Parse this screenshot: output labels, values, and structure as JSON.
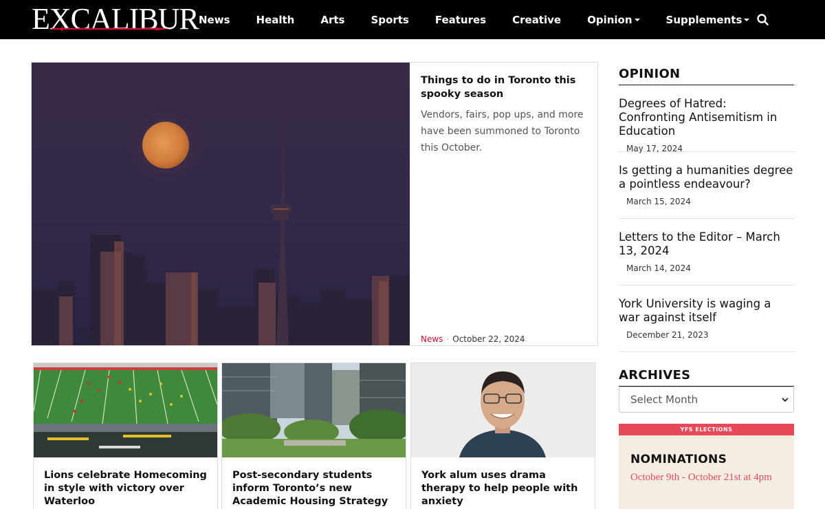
{
  "site": {
    "logo_text": "EXCALIBUR"
  },
  "nav": {
    "items": [
      {
        "label": "News"
      },
      {
        "label": "Health"
      },
      {
        "label": "Arts"
      },
      {
        "label": "Sports"
      },
      {
        "label": "Features"
      },
      {
        "label": "Creative"
      },
      {
        "label": "Opinion"
      },
      {
        "label": "Supplements"
      }
    ],
    "search_icon": "search-icon"
  },
  "feature": {
    "title": "Things to do in Toronto this spooky season",
    "excerpt": "Vendors, fairs, pop ups, and more have been summoned to Toronto this October.",
    "category": "News",
    "date": "October 22, 2024"
  },
  "cards": [
    {
      "title": "Lions celebrate Homecoming in style with victory over Waterloo"
    },
    {
      "title": "Post-secondary students inform Toronto’s new Academic Housing Strategy"
    },
    {
      "title": "York alum uses drama therapy to help people with anxiety"
    }
  ],
  "sidebar": {
    "opinion_heading": "OPINION",
    "opinion": [
      {
        "title": "Degrees of Hatred: Confronting Antisemitism in Education",
        "date": "May 17, 2024"
      },
      {
        "title": "Is getting a humanities degree a pointless endeavour?",
        "date": "March 15, 2024"
      },
      {
        "title": "Letters to the Editor – March 13, 2024",
        "date": "March 14, 2024"
      },
      {
        "title": "York University is waging a war against itself",
        "date": "December 21, 2023"
      }
    ],
    "archives_heading": "ARCHIVES",
    "archives_select": "Select Month"
  },
  "ad": {
    "bar": "YFS ELECTIONS",
    "title": "NOMINATIONS",
    "dates": "October 9th - October 21st at 4pm"
  },
  "colors": {
    "nav_bg": "#000000",
    "accent_red": "#c8102e",
    "ad_red": "#e8495a",
    "ad_bg": "#f6ede2"
  }
}
